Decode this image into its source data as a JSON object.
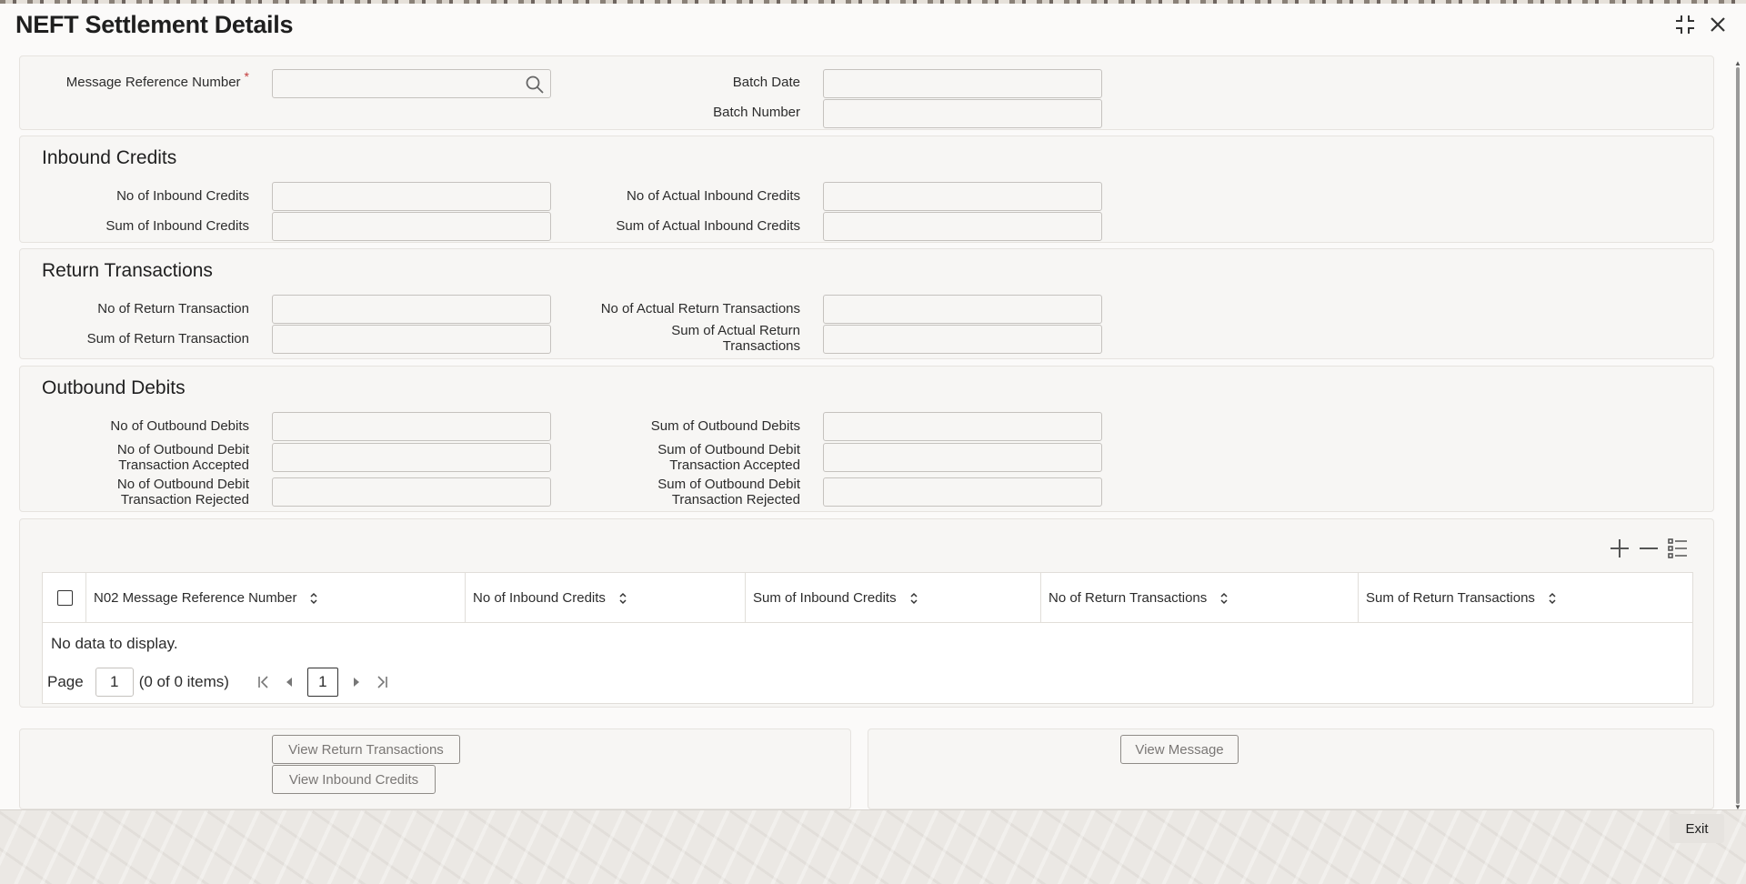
{
  "window": {
    "title": "NEFT Settlement Details"
  },
  "header": {
    "message_reference_label": "Message Reference Number",
    "required_mark": "*",
    "batch_date_label": "Batch Date",
    "batch_number_label": "Batch Number"
  },
  "inbound": {
    "title": "Inbound Credits",
    "no_label": "No of Inbound Credits",
    "sum_label": "Sum of Inbound Credits",
    "no_actual_label": "No of Actual Inbound Credits",
    "sum_actual_label": "Sum of Actual Inbound Credits"
  },
  "returns": {
    "title": "Return Transactions",
    "no_label": "No of Return Transaction",
    "sum_label": "Sum of Return Transaction",
    "no_actual_label": "No of Actual Return Transactions",
    "sum_actual_label_1": "Sum of Actual Return",
    "sum_actual_label_2": "Transactions"
  },
  "outbound": {
    "title": "Outbound Debits",
    "no_label": "No of Outbound Debits",
    "sum_label": "Sum of Outbound Debits",
    "no_accepted_1": "No of Outbound Debit",
    "no_accepted_2": "Transaction Accepted",
    "sum_accepted_1": "Sum of Outbound Debit",
    "sum_accepted_2": "Transaction Accepted",
    "no_rejected_1": "No of Outbound Debit",
    "no_rejected_2": "Transaction Rejected",
    "sum_rejected_1": "Sum of Outbound Debit",
    "sum_rejected_2": "Transaction Rejected"
  },
  "grid": {
    "columns": [
      "N02 Message Reference Number",
      "No of Inbound Credits",
      "Sum of Inbound Credits",
      "No of Return Transactions",
      "Sum of Return Transactions"
    ],
    "empty_text": "No data to display.",
    "page_label": "Page",
    "page_value": "1",
    "items_text": "(0 of 0 items)",
    "current_page": "1"
  },
  "buttons": {
    "view_return": "View Return Transactions",
    "view_inbound": "View Inbound Credits",
    "view_message": "View Message",
    "exit": "Exit"
  },
  "colors": {
    "required": "#c23a3a",
    "panel_bg": "#f7f6f4",
    "window_bg": "#fbfaf9"
  }
}
